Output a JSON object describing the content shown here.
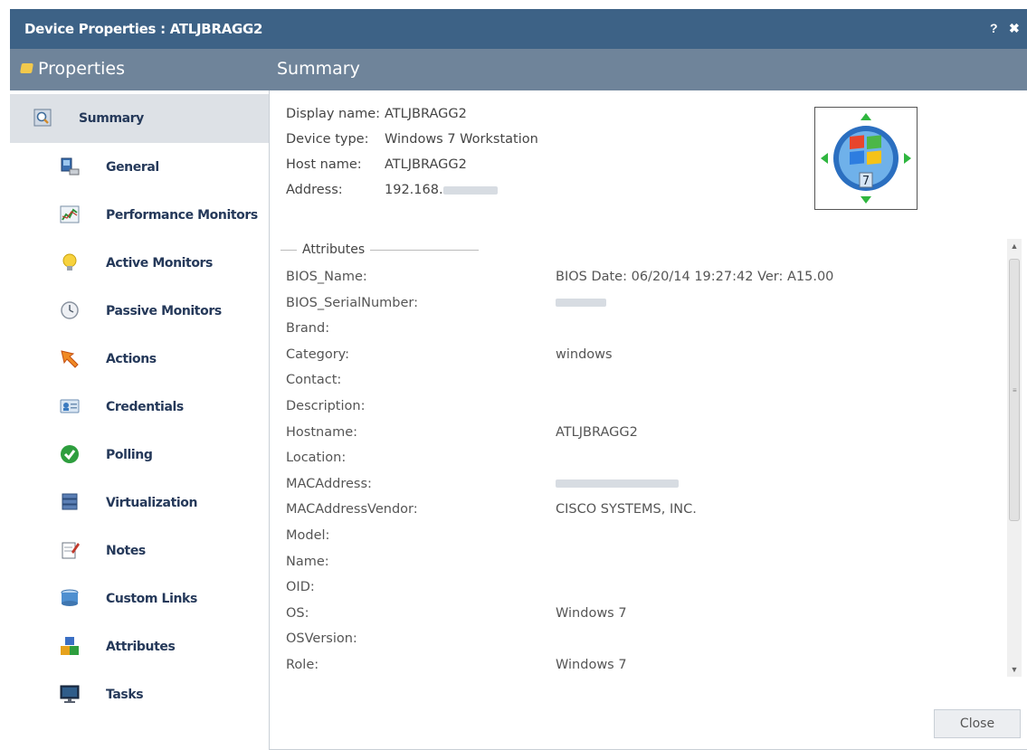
{
  "window": {
    "title": "Device Properties : ATLJBRAGG2",
    "help_label": "?",
    "close_label": "✖"
  },
  "header": {
    "left_title": "Properties",
    "right_title": "Summary"
  },
  "sidebar": {
    "items": [
      {
        "label": "Summary",
        "icon": "summary-icon"
      },
      {
        "label": "General",
        "icon": "computer-icon"
      },
      {
        "label": "Performance Monitors",
        "icon": "chart-icon"
      },
      {
        "label": "Active Monitors",
        "icon": "lightbulb-icon"
      },
      {
        "label": "Passive Monitors",
        "icon": "clock-icon"
      },
      {
        "label": "Actions",
        "icon": "action-arrow-icon"
      },
      {
        "label": "Credentials",
        "icon": "id-card-icon"
      },
      {
        "label": "Polling",
        "icon": "checkmark-icon"
      },
      {
        "label": "Virtualization",
        "icon": "server-stack-icon"
      },
      {
        "label": "Notes",
        "icon": "notepad-icon"
      },
      {
        "label": "Custom Links",
        "icon": "links-icon"
      },
      {
        "label": "Attributes",
        "icon": "blocks-icon"
      },
      {
        "label": "Tasks",
        "icon": "monitor-icon"
      }
    ]
  },
  "summary": {
    "display_name_label": "Display name:",
    "display_name_value": "ATLJBRAGG2",
    "device_type_label": "Device type:",
    "device_type_value": "Windows 7 Workstation",
    "host_name_label": "Host name:",
    "host_name_value": "ATLJBRAGG2",
    "address_label": "Address:",
    "address_value": "192.168."
  },
  "attributes": {
    "legend": "Attributes",
    "rows": [
      {
        "key": "BIOS_Name:",
        "value": "BIOS Date: 06/20/14 19:27:42 Ver: A15.00"
      },
      {
        "key": "BIOS_SerialNumber:",
        "value": "",
        "redacted": true
      },
      {
        "key": "Brand:",
        "value": ""
      },
      {
        "key": "Category:",
        "value": "windows"
      },
      {
        "key": "Contact:",
        "value": ""
      },
      {
        "key": "Description:",
        "value": ""
      },
      {
        "key": "Hostname:",
        "value": "ATLJBRAGG2"
      },
      {
        "key": "Location:",
        "value": ""
      },
      {
        "key": "MACAddress:",
        "value": "",
        "redacted": true
      },
      {
        "key": "MACAddressVendor:",
        "value": "CISCO SYSTEMS, INC."
      },
      {
        "key": "Model:",
        "value": ""
      },
      {
        "key": "Name:",
        "value": ""
      },
      {
        "key": "OID:",
        "value": ""
      },
      {
        "key": "OS:",
        "value": "Windows 7"
      },
      {
        "key": "OSVersion:",
        "value": ""
      },
      {
        "key": "Role:",
        "value": "Windows 7"
      }
    ]
  },
  "footer": {
    "close_label": "Close"
  },
  "colors": {
    "titlebar": "#3d6286",
    "headerbar": "#6f849a",
    "nav_text": "#25395a",
    "active_bg": "#dde1e6"
  }
}
